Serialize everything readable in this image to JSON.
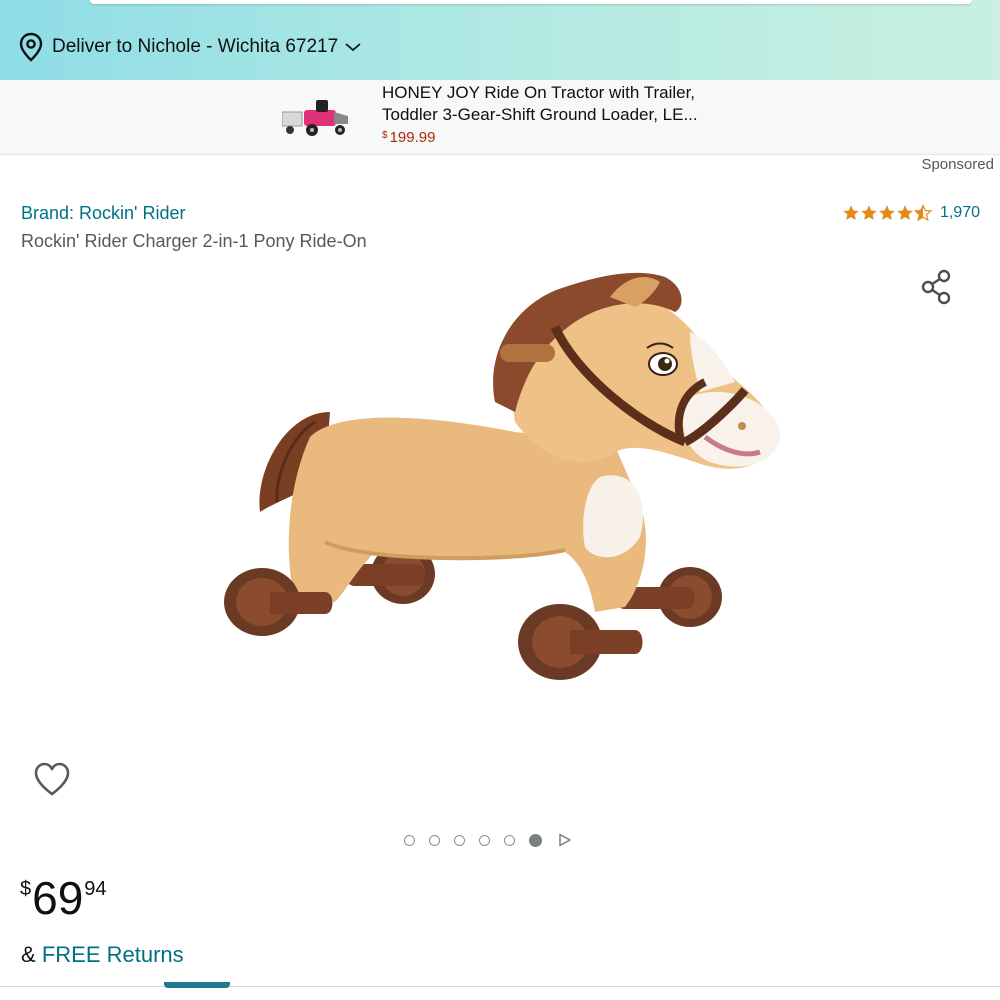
{
  "header": {
    "deliver_text": "Deliver to Nichole - Wichita 67217"
  },
  "sponsored_product": {
    "title_line1": "HONEY JOY Ride On Tractor with Trailer,",
    "title_line2": "Toddler 3-Gear-Shift Ground Loader, LE...",
    "price_symbol": "$",
    "price_value": "199.99",
    "label": "Sponsored"
  },
  "product": {
    "brand": "Brand: Rockin' Rider",
    "title": "Rockin' Rider Charger 2-in-1 Pony Ride-On",
    "rating_count": "1,970",
    "rating_stars": 4.5,
    "image_count": 6,
    "active_image_index": 5,
    "price_symbol": "$",
    "price_whole": "69",
    "price_fraction": "94",
    "returns_prefix": "&",
    "returns_link": "FREE Returns"
  },
  "icons": {
    "location": "location-pin-icon",
    "chevron": "chevron-down-icon",
    "share": "share-icon",
    "wishlist": "heart-icon",
    "next": "play-next-icon",
    "star": "star-icon"
  },
  "colors": {
    "link": "#007185",
    "price_red": "#b12704",
    "star": "#e68a17"
  }
}
